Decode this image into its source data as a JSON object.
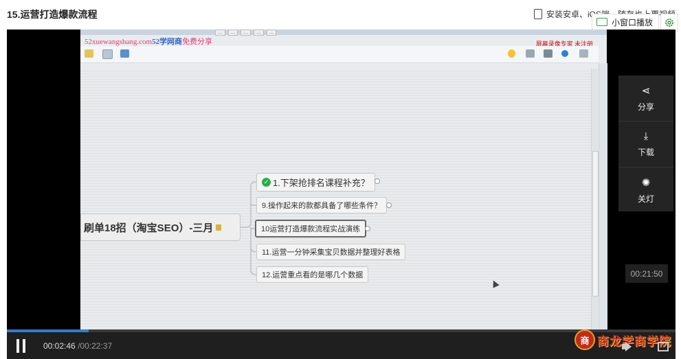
{
  "page": {
    "title": "15.运营打造爆款流程"
  },
  "header": {
    "install_text": "安装安卓、iOS端，随存也上更视频",
    "mini_player_label": "小窗口播放",
    "icons": {
      "phone": "phone-icon",
      "mini": "tv-icon",
      "settings": "gear-icon"
    }
  },
  "video": {
    "watermark": {
      "site": "52xuewangshang.com",
      "brand": "52学网商",
      "suffix": "免费分享"
    },
    "recorder_watermark": "屏幕录像专家  未注册",
    "tabs": [
      "...",
      "...",
      "...",
      "...",
      "..."
    ],
    "mindmap": {
      "root": "刷单18招（淘宝SEO）-三月",
      "children": [
        {
          "label": "1.下架抢排名课程补充？",
          "done": true
        },
        {
          "label": "9.操作起来的款都具备了哪些条件？"
        },
        {
          "label": "10运营打造爆款流程实战演练",
          "selected": true
        },
        {
          "label": "11.运营一分钟采集宝贝数据并整理好表格"
        },
        {
          "label": "12.运营重点看的是哪几个数据"
        }
      ]
    }
  },
  "side_panel": {
    "items": [
      {
        "label": "分享",
        "icon": "share-icon"
      },
      {
        "label": "下载",
        "icon": "download-icon"
      },
      {
        "label": "关灯",
        "icon": "lightbulb-icon"
      }
    ]
  },
  "player": {
    "hover_time": "00:21:50",
    "current_time": "00:02:46",
    "separator": "/",
    "duration": "00:22:37",
    "progress_fraction": 0.1224,
    "logo": {
      "mark": "商",
      "text": "商龙学商学院"
    }
  },
  "colors": {
    "accent": "#2f7fd6",
    "done_check": "#27ae4a",
    "logo_red": "#c9321f"
  }
}
